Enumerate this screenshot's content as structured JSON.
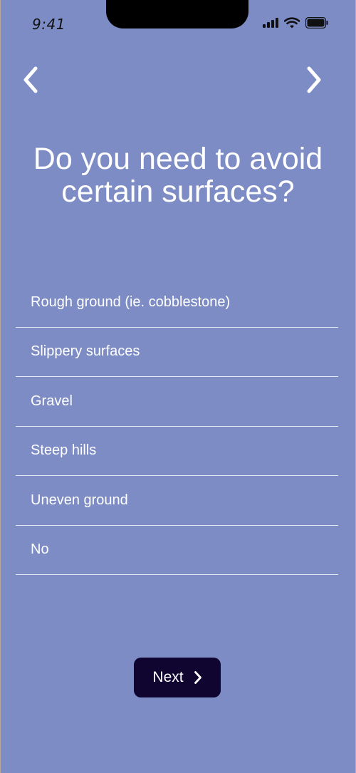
{
  "status_bar": {
    "time": "9:41"
  },
  "navigation": {
    "back_icon": "chevron-left-icon",
    "forward_icon": "chevron-right-icon"
  },
  "question": {
    "line1": "Do you need to avoid",
    "line2": "certain surfaces?"
  },
  "options": [
    {
      "label": "Rough ground (ie. cobblestone)"
    },
    {
      "label": "Slippery surfaces"
    },
    {
      "label": "Gravel"
    },
    {
      "label": "Steep hills"
    },
    {
      "label": "Uneven ground"
    },
    {
      "label": "No"
    }
  ],
  "next_button": {
    "label": "Next",
    "icon": "chevron-right-icon"
  },
  "colors": {
    "background": "#7d8cc4",
    "button": "#0f0530",
    "text": "#ffffff"
  }
}
